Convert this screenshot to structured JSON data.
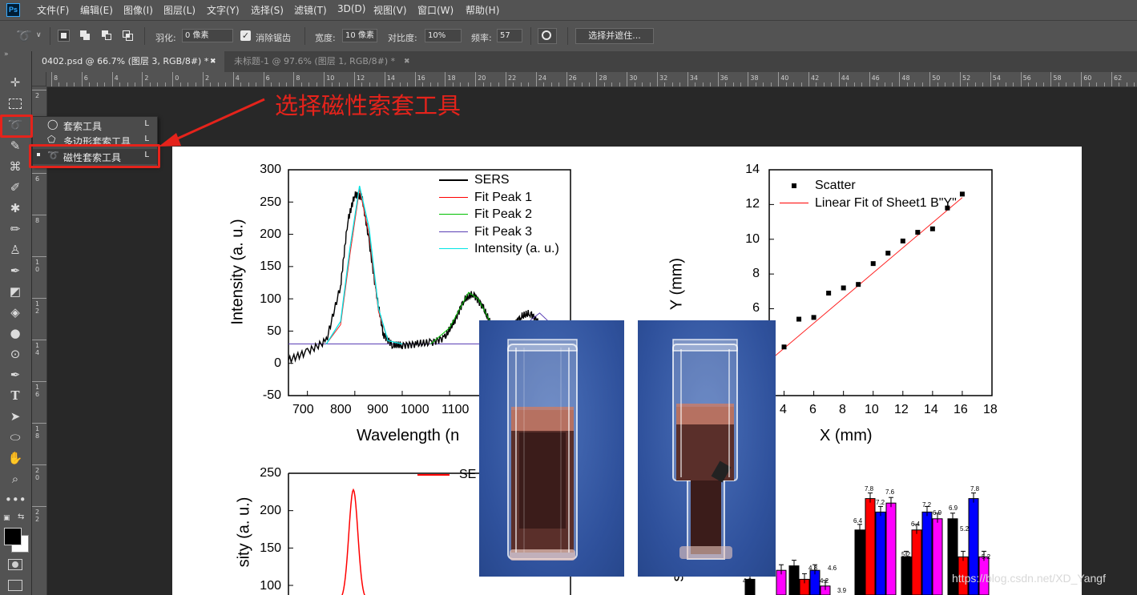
{
  "app": {
    "logo_text": "Ps"
  },
  "menu": [
    "文件(F)",
    "编辑(E)",
    "图像(I)",
    "图层(L)",
    "文字(Y)",
    "选择(S)",
    "滤镜(T)",
    "3D(D)",
    "视图(V)",
    "窗口(W)",
    "帮助(H)"
  ],
  "options": {
    "feather_label": "羽化:",
    "feather_value": "0 像素",
    "antialias_label": "消除锯齿",
    "width_label": "宽度:",
    "width_value": "10 像素",
    "contrast_label": "对比度:",
    "contrast_value": "10%",
    "frequency_label": "频率:",
    "frequency_value": "57",
    "select_mask_button": "选择并遮住..."
  },
  "tabs": [
    {
      "title": "0402.psd @ 66.7% (图层 3, RGB/8#) *",
      "active": true
    },
    {
      "title": "未标题-1 @ 97.6% (图层 1, RGB/8#) *",
      "active": false
    }
  ],
  "ruler": {
    "top": [
      "8",
      "6",
      "4",
      "2",
      "0",
      "2",
      "4",
      "6",
      "8",
      "10",
      "12",
      "14",
      "16",
      "18",
      "20",
      "22",
      "24",
      "26",
      "28",
      "30",
      "32",
      "34",
      "36",
      "38",
      "40",
      "42",
      "44",
      "46",
      "48",
      "50",
      "52",
      "54",
      "56",
      "58",
      "60",
      "62"
    ],
    "left": [
      "2",
      "4",
      "6",
      "8",
      "1 0",
      "1 2",
      "1 4",
      "1 6",
      "1 8",
      "2 0",
      "2 2"
    ]
  },
  "flyout": [
    {
      "label": "套索工具",
      "key": "L"
    },
    {
      "label": "多边形套索工具",
      "key": "L"
    },
    {
      "label": "磁性套索工具",
      "key": "L",
      "active": true
    }
  ],
  "annotation": "选择磁性索套工具",
  "watermark": "https://blog.csdn.net/XD_Yangf",
  "colors": {
    "accent_red": "#e5231b",
    "ui_dark": "#535353",
    "workspace": "#282828"
  },
  "charts": {
    "spectrum": {
      "ylabel": "Intensity (a. u.)",
      "xlabel": "Wavelength (n",
      "yticks": [
        "300",
        "250",
        "200",
        "150",
        "100",
        "50",
        "0",
        "-50"
      ],
      "xticks": [
        "700",
        "800",
        "900",
        "1000",
        "1100"
      ],
      "legend": [
        "SERS",
        "Fit Peak 1",
        "Fit Peak 2",
        "Fit Peak 3",
        "Intensity (a. u.)"
      ]
    },
    "scatter": {
      "ylabel": "Y (mm)",
      "xlabel": "X (mm)",
      "yticks": [
        "14",
        "12",
        "10",
        "8",
        "6"
      ],
      "xticks": [
        "4",
        "6",
        "8",
        "10",
        "12",
        "14",
        "16",
        "18"
      ],
      "legend": [
        "Scatter",
        "Linear Fit of Sheet1 B\"Y\""
      ]
    },
    "peak": {
      "ylabel": "sity (a. u.)",
      "yticks": [
        "250",
        "200",
        "150",
        "100"
      ],
      "legend": "SE"
    },
    "bars": {
      "ylabel": "sity",
      "labels": [
        "4.2",
        "4.6",
        "4.8",
        "4.2",
        "4.6",
        "3.9",
        "6.4",
        "7.8",
        "7.2",
        "7.6",
        "5.2",
        "6.4",
        "7.2",
        "6.9",
        "6.9",
        "5.2",
        "7.8",
        "5.2"
      ]
    }
  },
  "chart_data": [
    {
      "type": "line",
      "ylabel": "Intensity (a. u.)",
      "xlabel": "Wavelength (n",
      "xlim": [
        660,
        1255
      ],
      "ylim": [
        -50,
        300
      ],
      "series": [
        {
          "name": "SERS",
          "x": [
            660,
            700,
            740,
            770,
            785,
            800,
            815,
            830,
            845,
            860,
            880,
            900,
            930,
            960,
            990,
            1010,
            1030,
            1050,
            1070,
            1090,
            1110,
            1130,
            1150,
            1170,
            1190,
            1210
          ],
          "y": [
            5,
            18,
            35,
            120,
            220,
            262,
            258,
            190,
            110,
            45,
            28,
            28,
            30,
            32,
            40,
            65,
            98,
            108,
            88,
            55,
            42,
            55,
            72,
            78,
            62,
            40
          ]
        },
        {
          "name": "Fit Peak 1",
          "x": [
            740,
            770,
            790,
            810,
            830,
            850,
            870,
            900
          ],
          "y": [
            30,
            60,
            170,
            270,
            200,
            80,
            35,
            30
          ]
        },
        {
          "name": "Fit Peak 2",
          "x": [
            960,
            1000,
            1040,
            1060,
            1100,
            1140
          ],
          "y": [
            30,
            55,
            110,
            100,
            45,
            30
          ]
        },
        {
          "name": "Fit Peak 3",
          "x": [
            1100,
            1150,
            1190,
            1230
          ],
          "y": [
            30,
            55,
            78,
            50
          ]
        },
        {
          "name": "Intensity (a. u.)",
          "x": [
            740,
            770,
            790,
            810,
            830,
            850,
            870,
            900
          ],
          "y": [
            30,
            65,
            180,
            275,
            210,
            85,
            35,
            30
          ]
        }
      ]
    },
    {
      "type": "scatter",
      "ylabel": "Y (mm)",
      "xlabel": "X (mm)",
      "xlim": [
        3,
        18
      ],
      "ylim": [
        5,
        14
      ],
      "series": [
        {
          "name": "Scatter",
          "x": [
            4,
            5,
            6,
            7,
            8,
            9,
            10,
            11,
            12,
            13,
            14,
            15,
            16
          ],
          "y": [
            3.8,
            5.4,
            5.5,
            6.9,
            7.2,
            7.4,
            8.6,
            9.2,
            9.9,
            10.4,
            10.6,
            11.8,
            12.6
          ]
        },
        {
          "name": "Linear Fit of Sheet1 B\"Y\"",
          "x": [
            3,
            16
          ],
          "y": [
            3.0,
            12.4
          ]
        }
      ]
    },
    {
      "type": "line",
      "ylabel": "sity (a. u.)",
      "ylim": [
        100,
        250
      ],
      "series": [
        {
          "name": "SE",
          "values": [
            90,
            150,
            200,
            228,
            200,
            150,
            90
          ]
        }
      ]
    },
    {
      "type": "bar",
      "ylabel": "sity",
      "series": [
        {
          "color": "#000000",
          "values": [
            4.2,
            4.8,
            6.4,
            5.2,
            6.9
          ]
        },
        {
          "color": "#ff0000",
          "values": [
            null,
            4.2,
            7.8,
            6.4,
            5.2
          ]
        },
        {
          "color": "#0000ff",
          "values": [
            null,
            4.6,
            7.2,
            7.2,
            7.8
          ]
        },
        {
          "color": "#ff00ff",
          "values": [
            4.6,
            3.9,
            7.6,
            6.9,
            5.2
          ]
        }
      ]
    }
  ]
}
